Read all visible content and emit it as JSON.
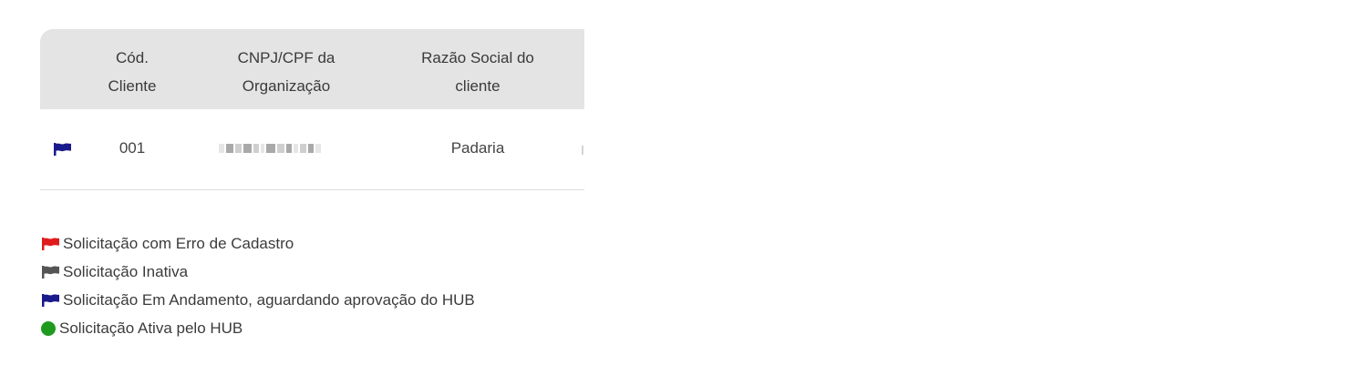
{
  "table": {
    "headers": {
      "code": "Cód.\nCliente",
      "document": "CNPJ/CPF da\nOrganização",
      "company_name": "Razão Social do\ncliente"
    },
    "rows": [
      {
        "status_icon": "flag-blue-icon",
        "code": "001",
        "document": "",
        "company_name": "Padaria"
      }
    ]
  },
  "legend": [
    {
      "icon": "flag-red-icon",
      "color": "#e01b1b",
      "label": "Solicitação com Erro de Cadastro"
    },
    {
      "icon": "flag-gray-icon",
      "color": "#555555",
      "label": "Solicitação Inativa"
    },
    {
      "icon": "flag-blue-icon",
      "color": "#1a1a8c",
      "label": "Solicitação Em Andamento, aguardando aprovação do HUB"
    },
    {
      "icon": "green-dot-icon",
      "color": "#1f9a1f",
      "label": "Solicitação Ativa pelo HUB"
    }
  ]
}
